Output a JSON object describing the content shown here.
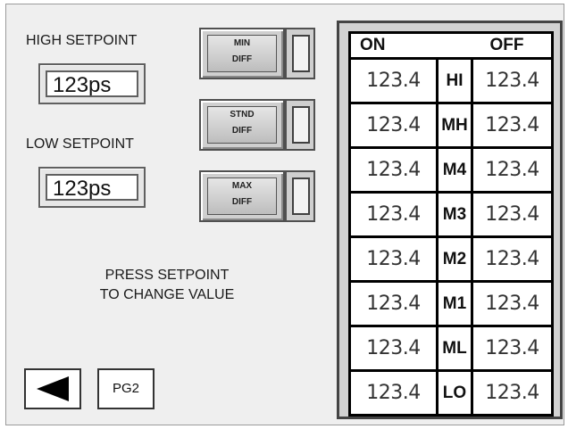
{
  "left": {
    "high_setpoint_label": "HIGH SETPOINT",
    "high_setpoint_value": "123ps",
    "low_setpoint_label": "LOW SETPOINT",
    "low_setpoint_value": "123ps",
    "press_line1": "PRESS SETPOINT",
    "press_line2": "TO CHANGE VALUE"
  },
  "diff_buttons": [
    {
      "line1": "MIN",
      "line2": "DIFF"
    },
    {
      "line1": "STND",
      "line2": "DIFF"
    },
    {
      "line1": "MAX",
      "line2": "DIFF"
    }
  ],
  "nav": {
    "back_icon": "left-triangle",
    "pg2_label": "PG2"
  },
  "table": {
    "header_on": "ON",
    "header_off": "OFF",
    "rows": [
      {
        "on": "123.4",
        "level": "HI",
        "off": "123.4"
      },
      {
        "on": "123.4",
        "level": "MH",
        "off": "123.4"
      },
      {
        "on": "123.4",
        "level": "M4",
        "off": "123.4"
      },
      {
        "on": "123.4",
        "level": "M3",
        "off": "123.4"
      },
      {
        "on": "123.4",
        "level": "M2",
        "off": "123.4"
      },
      {
        "on": "123.4",
        "level": "M1",
        "off": "123.4"
      },
      {
        "on": "123.4",
        "level": "ML",
        "off": "123.4"
      },
      {
        "on": "123.4",
        "level": "LO",
        "off": "123.4"
      }
    ]
  }
}
